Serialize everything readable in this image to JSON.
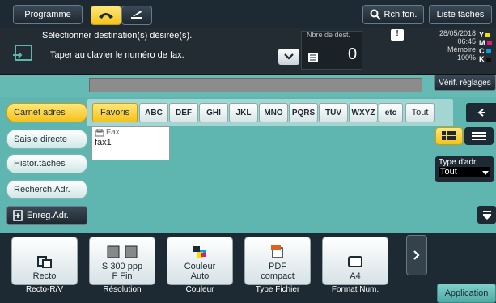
{
  "header": {
    "programme_label": "Programme",
    "search_label": "Rch.fon.",
    "job_list_label": "Liste tâches"
  },
  "message": {
    "line1": "Sélectionner destination(s) désirée(s).",
    "line2": "Taper au clavier le numéro de fax.",
    "dest_count_label": "Nbre de dest.",
    "dest_count_value": "0",
    "date": "28/05/2018",
    "time": "06:45",
    "memory_label": "Mémoire",
    "memory_value": "100%",
    "toner_letters": [
      "Y",
      "M",
      "C",
      "K"
    ],
    "check_settings_label": "Vérif. réglages"
  },
  "left_menu": {
    "items": [
      {
        "label": "Carnet adres",
        "selected": true
      },
      {
        "label": "Saisie directe",
        "selected": false
      },
      {
        "label": "Histor.tâches",
        "selected": false
      },
      {
        "label": "Recherch.Adr.",
        "selected": false
      }
    ],
    "register_label": "Enreg.Adr."
  },
  "tabs": [
    "Favoris",
    "ABC",
    "DEF",
    "GHI",
    "JKL",
    "MNO",
    "PQRS",
    "TUV",
    "WXYZ",
    "etc",
    "Tout"
  ],
  "address_list": {
    "type_label": "Fax",
    "entries": [
      "fax1"
    ]
  },
  "type_filter": {
    "label": "Type d'adr.",
    "value": "Tout"
  },
  "functions": [
    {
      "value": "Recto",
      "caption": "Recto-R/V",
      "icon": "duplex-icon"
    },
    {
      "value": "S 300 ppp\nF Fin",
      "caption": "Résolution",
      "icon": "resolution-icon"
    },
    {
      "value": "Couleur\nAuto",
      "caption": "Couleur",
      "icon": "color-icon"
    },
    {
      "value": "PDF\ncompact",
      "caption": "Type Fichier",
      "icon": "pdf-icon"
    },
    {
      "value": "A4",
      "caption": "Format Num.",
      "icon": "paper-size-icon"
    }
  ],
  "application_label": "Application",
  "colors": {
    "background": "#5fb5b0",
    "accent_yellow": "#f5c21b",
    "dark_bar": "#1e2a33"
  }
}
